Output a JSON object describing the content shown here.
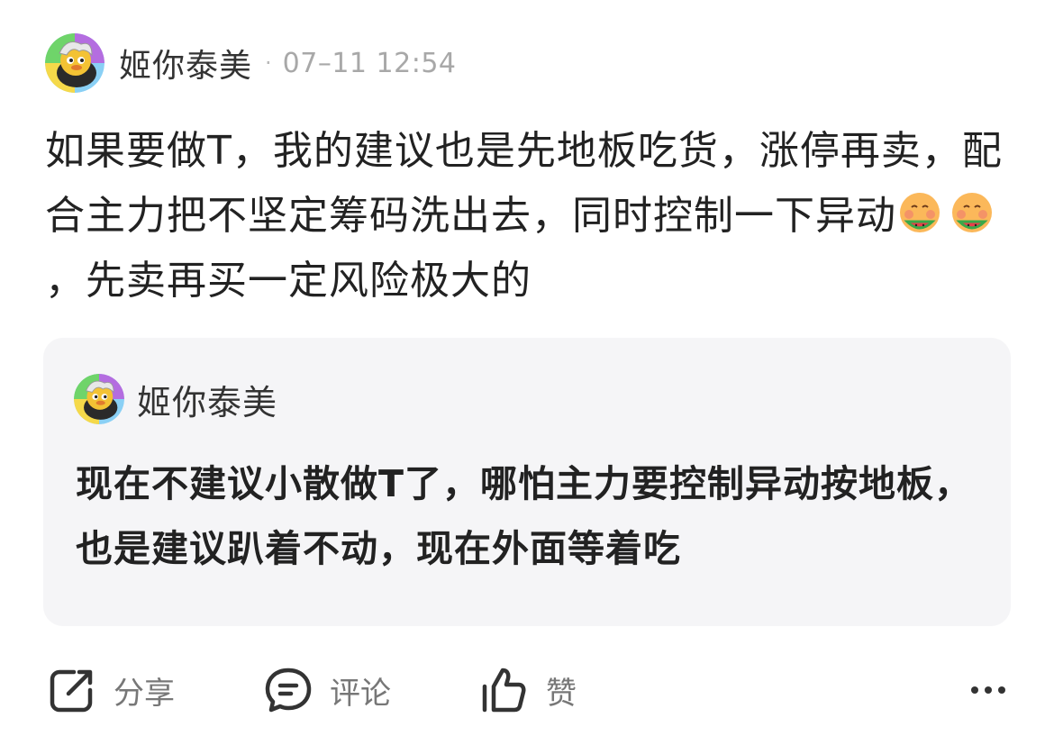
{
  "post": {
    "author": "姬你泰美",
    "separator": "·",
    "timestamp": "07–11 12:54",
    "text_part1": "如果要做T，我的建议也是先地板吃货，涨停再卖，配合主力把不坚定筹码洗出去，同时控制一下异动",
    "text_part2": "，先卖再买一定风险极大的",
    "emojis": [
      "watermelon-face-emoji",
      "watermelon-face-emoji"
    ]
  },
  "quote": {
    "author": "姬你泰美",
    "text": "现在不建议小散做T了，哪怕主力要控制异动按地板，也是建议趴着不动，现在外面等着吃"
  },
  "actions": {
    "share_label": "分享",
    "comment_label": "评论",
    "like_label": "赞",
    "more_icon": "more-icon"
  }
}
